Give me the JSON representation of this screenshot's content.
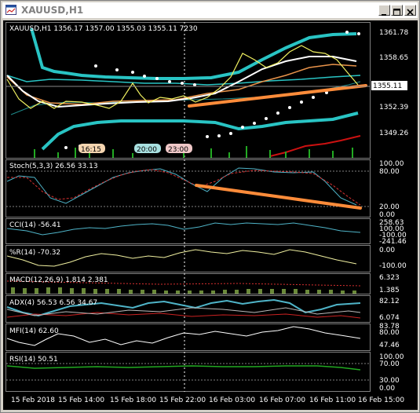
{
  "window": {
    "title": "XAUUSD,H1"
  },
  "price_panel": {
    "header": "XAUUSD,H1  1356.17 1357.00 1355.03 1355.11  7230",
    "y_ticks": [
      "1361.78",
      "1358.65",
      "1355.11",
      "1352.39",
      "1349.26"
    ],
    "current_price": "1355.11",
    "session_labels": [
      {
        "text": "16:15",
        "color": "#f5d5b0"
      },
      {
        "text": "20:00",
        "color": "#a8e0e0"
      },
      {
        "text": "23:00",
        "color": "#f0c8c8"
      }
    ],
    "colors": {
      "bands": "#29c4c4",
      "trendline": "#ff8c3a",
      "yellow": "#f0f060",
      "white": "#ffffff",
      "orange": "#e8934a",
      "red": "#cc1111",
      "volume": "#22aa22"
    }
  },
  "indicators": [
    {
      "id": "stoch",
      "label": "Stoch(5,3,3) 26.56 33.13",
      "ticks": [
        "100.00",
        "80.00",
        "20.00",
        "0.00"
      ]
    },
    {
      "id": "cci",
      "label": "CCI(14) -56.41",
      "ticks": [
        "258.63",
        "100.00",
        "-100.00",
        "-241.46"
      ]
    },
    {
      "id": "wpr",
      "label": "%R(14) -70.32",
      "ticks": [
        "0.00",
        "-100.00"
      ]
    },
    {
      "id": "macd",
      "label": "MACD(12,26,9) 1.814 2.381",
      "ticks": [
        "6.323",
        "1.385"
      ]
    },
    {
      "id": "adx",
      "label": "ADX(4) 56.53 6.56 34.67",
      "ticks": [
        "82.12",
        "6.074"
      ]
    },
    {
      "id": "mfi",
      "label": "MFI(14) 62.60",
      "ticks": [
        "83.78",
        "80.00",
        "47.46"
      ]
    },
    {
      "id": "rsi",
      "label": "RSI(14) 50.51",
      "ticks": [
        "100.00",
        "70.00",
        "30.00",
        "0.00"
      ]
    }
  ],
  "time_axis": [
    "15 Feb 2018",
    "15 Feb 14:00",
    "15 Feb 18:00",
    "15 Feb 22:00",
    "16 Feb 03:00",
    "16 Feb 07:00",
    "16 Feb 11:00",
    "16 Feb 15:00"
  ]
}
